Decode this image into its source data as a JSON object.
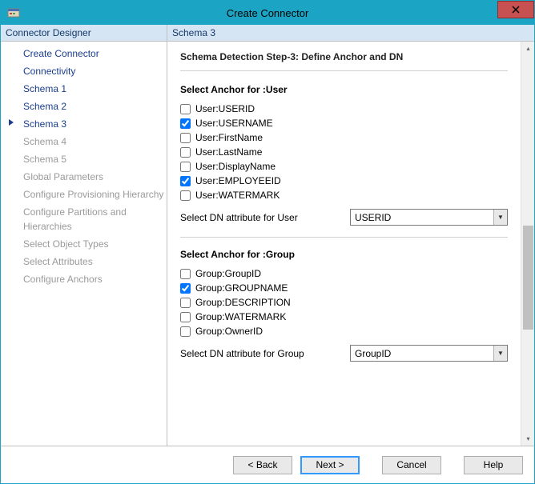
{
  "window": {
    "title": "Create Connector"
  },
  "sidebar": {
    "header": "Connector Designer",
    "items": [
      {
        "label": "Create Connector",
        "state": "done"
      },
      {
        "label": "Connectivity",
        "state": "done"
      },
      {
        "label": "Schema 1",
        "state": "done"
      },
      {
        "label": "Schema 2",
        "state": "done"
      },
      {
        "label": "Schema 3",
        "state": "current"
      },
      {
        "label": "Schema 4",
        "state": "disabled"
      },
      {
        "label": "Schema 5",
        "state": "disabled"
      },
      {
        "label": "Global Parameters",
        "state": "disabled"
      },
      {
        "label": "Configure Provisioning Hierarchy",
        "state": "disabled"
      },
      {
        "label": "Configure Partitions and Hierarchies",
        "state": "disabled"
      },
      {
        "label": "Select Object Types",
        "state": "disabled"
      },
      {
        "label": "Select Attributes",
        "state": "disabled"
      },
      {
        "label": "Configure Anchors",
        "state": "disabled"
      }
    ]
  },
  "main": {
    "header": "Schema 3",
    "step_title": "Schema Detection Step-3: Define Anchor and DN",
    "user_section": {
      "label": "Select Anchor for :User",
      "checkboxes": [
        {
          "label": "User:USERID",
          "checked": false
        },
        {
          "label": "User:USERNAME",
          "checked": true
        },
        {
          "label": "User:FirstName",
          "checked": false
        },
        {
          "label": "User:LastName",
          "checked": false
        },
        {
          "label": "User:DisplayName",
          "checked": false
        },
        {
          "label": "User:EMPLOYEEID",
          "checked": true
        },
        {
          "label": "User:WATERMARK",
          "checked": false
        }
      ],
      "dn_label": "Select DN attribute for User",
      "dn_value": "USERID"
    },
    "group_section": {
      "label": "Select Anchor for :Group",
      "checkboxes": [
        {
          "label": "Group:GroupID",
          "checked": false
        },
        {
          "label": "Group:GROUPNAME",
          "checked": true
        },
        {
          "label": "Group:DESCRIPTION",
          "checked": false
        },
        {
          "label": "Group:WATERMARK",
          "checked": false
        },
        {
          "label": "Group:OwnerID",
          "checked": false
        }
      ],
      "dn_label": "Select DN attribute for Group",
      "dn_value": "GroupID"
    }
  },
  "footer": {
    "back": "<  Back",
    "next": "Next  >",
    "cancel": "Cancel",
    "help": "Help"
  }
}
